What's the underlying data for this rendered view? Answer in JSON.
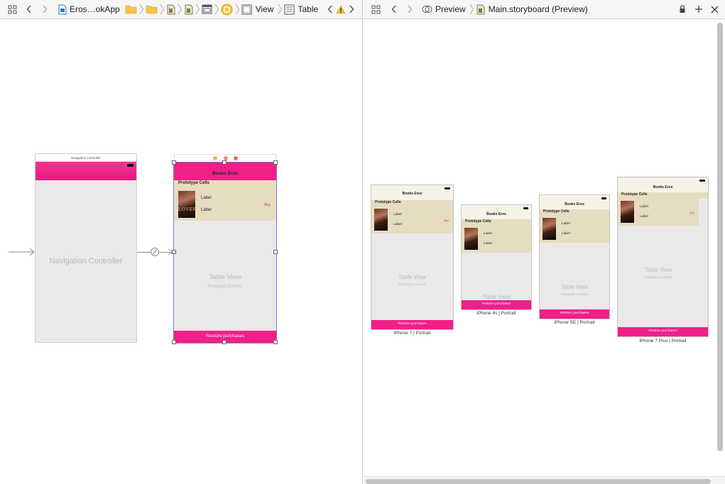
{
  "left_jumpbar": {
    "project": "Eros…okApp",
    "view": "View",
    "table": "Table"
  },
  "right_jumpbar": {
    "mode": "Preview",
    "file": "Main.storyboard (Preview)"
  },
  "storyboard": {
    "nav_controller": {
      "title": "Navigation Controller",
      "center_label": "Navigation Controller"
    },
    "table_scene": {
      "nav_title": "Books Eros",
      "section_header": "Prototype Cells",
      "cell_label_1": "Label",
      "cell_label_2": "Label",
      "buy": "Buy",
      "cover_text": "LOVER",
      "table_view_title": "Table View",
      "table_view_sub": "Prototype Content",
      "restore": "Restore purchases"
    }
  },
  "preview": {
    "devices": [
      {
        "name": "iPhone 7",
        "orientation": "Portrait",
        "caption": "iPhone 7 | Portrait"
      },
      {
        "name": "iPhone 4s",
        "orientation": "Portrait",
        "caption": "iPhone 4s | Portrait"
      },
      {
        "name": "iPhone SE",
        "orientation": "Portrait",
        "caption": "iPhone SE | Portrait"
      },
      {
        "name": "iPhone 7 Plus",
        "orientation": "Portrait",
        "caption": "iPhone 7 Plus | Portrait"
      }
    ],
    "nav_title": "Books Eros",
    "section_header": "Prototype Cells",
    "label": "Label",
    "buy": "Buy",
    "cover_text": "LOVER",
    "table_view_title": "Table View",
    "table_view_sub": "Prototype Content",
    "restore": "Restore purchases"
  },
  "colors": {
    "accent_pink": "#f01f8a",
    "cell_beige": "#e6dcc0",
    "selection_blue": "#6c7fd8"
  }
}
